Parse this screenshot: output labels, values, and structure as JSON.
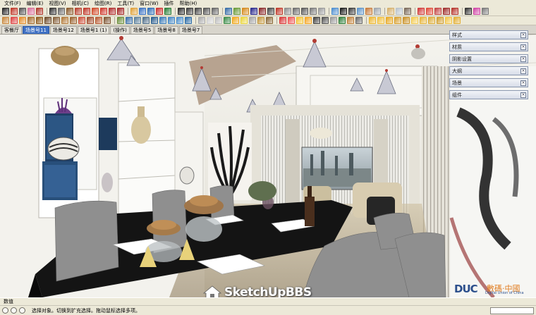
{
  "menu": [
    "文件(F)",
    "编辑(E)",
    "视图(V)",
    "相机(C)",
    "绘图(R)",
    "工具(T)",
    "窗口(W)",
    "插件",
    "帮助(H)"
  ],
  "toolbar_row1": [
    {
      "name": "select-tool-icon",
      "color": "#2a2a2a"
    },
    {
      "name": "pencil-icon",
      "color": "#c0392b"
    },
    {
      "name": "line-tool-icon",
      "color": "#555"
    },
    {
      "name": "eraser-icon",
      "color": "#d86f9a"
    },
    {
      "name": "paint-bucket-icon",
      "color": "#b03a2e"
    },
    {
      "sep": true
    },
    {
      "name": "rectangle-tool-icon",
      "color": "#333"
    },
    {
      "name": "circle-tool-icon",
      "color": "#6b6b6b"
    },
    {
      "name": "polygon-tool-icon",
      "color": "#8a5a2b"
    },
    {
      "name": "arc-tool-icon",
      "color": "#b8412f"
    },
    {
      "name": "push-pull-icon",
      "color": "#c0392b"
    },
    {
      "name": "follow-me-icon",
      "color": "#d14b2a"
    },
    {
      "name": "offset-tool-icon",
      "color": "#cf3a2f"
    },
    {
      "name": "move-tool-icon",
      "color": "#b23030"
    },
    {
      "name": "rotate-tool-icon",
      "color": "#a52a2a"
    },
    {
      "sep": true
    },
    {
      "name": "tape-measure-icon",
      "color": "#e0a23a"
    },
    {
      "name": "protractor-icon",
      "color": "#3b73c4"
    },
    {
      "name": "text-tool-icon",
      "color": "#2f6db5"
    },
    {
      "name": "axes-tool-icon",
      "color": "#c33"
    },
    {
      "name": "dimension-icon",
      "color": "#2b7f3a"
    },
    {
      "sep": true
    },
    {
      "name": "orbit-icon",
      "color": "#2c2c2c"
    },
    {
      "name": "pan-icon",
      "color": "#3d3d3d"
    },
    {
      "name": "zoom-icon",
      "color": "#444"
    },
    {
      "name": "zoom-window-icon",
      "color": "#555"
    },
    {
      "name": "zoom-extents-icon",
      "color": "#666"
    },
    {
      "sep": true
    },
    {
      "name": "component-icon",
      "color": "#3a6ea8"
    },
    {
      "name": "material-icon",
      "color": "#6a9b3a"
    },
    {
      "name": "section-plane-icon",
      "color": "#d68a1e"
    },
    {
      "name": "walk-icon",
      "color": "#2b2b8f"
    },
    {
      "name": "look-around-icon",
      "color": "#8b2b2b"
    },
    {
      "name": "position-camera-icon",
      "color": "#4a4a4a"
    },
    {
      "name": "iso-view-icon",
      "color": "#c0392b"
    },
    {
      "name": "top-view-icon",
      "color": "#8e8e8e"
    },
    {
      "name": "front-view-icon",
      "color": "#6d6d6d"
    },
    {
      "name": "right-view-icon",
      "color": "#5a5a5a"
    },
    {
      "name": "back-view-icon",
      "color": "#7a7a7a"
    },
    {
      "name": "left-view-icon",
      "color": "#9a9a9a"
    },
    {
      "sep": true
    },
    {
      "name": "xray-icon",
      "color": "#4f8fd0"
    },
    {
      "name": "wireframe-icon",
      "color": "#1c1c1c"
    },
    {
      "name": "hidden-line-icon",
      "color": "#3c3c3c"
    },
    {
      "name": "shaded-icon",
      "color": "#5e94c9"
    },
    {
      "name": "shaded-texture-icon",
      "color": "#c77b3c"
    },
    {
      "name": "monochrome-icon",
      "color": "#9fa6ad"
    },
    {
      "sep": true
    },
    {
      "name": "shadow-icon",
      "color": "#d5b06b"
    },
    {
      "name": "fog-icon",
      "color": "#b9c3cc"
    },
    {
      "name": "edge-style-icon",
      "color": "#7b6a5a"
    },
    {
      "sep": true
    },
    {
      "name": "plugin-a-icon",
      "color": "#d23a3a"
    },
    {
      "name": "plugin-b-icon",
      "color": "#e04c3c"
    },
    {
      "name": "plugin-c-icon",
      "color": "#c44646"
    },
    {
      "name": "plugin-d-icon",
      "color": "#a0302f"
    },
    {
      "name": "plugin-e-icon",
      "color": "#b7362f"
    },
    {
      "sep": true
    },
    {
      "name": "text-style-icon",
      "color": "#333"
    },
    {
      "name": "color-wheel-icon",
      "color": "#d247a8"
    },
    {
      "name": "extension-icon",
      "color": "#7a7a7a"
    }
  ],
  "toolbar_row2": [
    {
      "name": "make-group-icon",
      "color": "#c8873c"
    },
    {
      "name": "explode-icon",
      "color": "#d44"
    },
    {
      "name": "flip-icon",
      "color": "#e38d2a"
    },
    {
      "name": "align-icon",
      "color": "#a56a2a"
    },
    {
      "name": "stair-icon",
      "color": "#8f5a1c"
    },
    {
      "name": "railing-icon",
      "color": "#6e4b2a"
    },
    {
      "name": "fence-icon",
      "color": "#86603a"
    },
    {
      "name": "window-tool-icon",
      "color": "#b37a3a"
    },
    {
      "name": "door-tool-icon",
      "color": "#9b6431"
    },
    {
      "name": "roof-icon",
      "color": "#cc4f3a"
    },
    {
      "name": "wall-icon",
      "color": "#a04a2b"
    },
    {
      "name": "column-icon",
      "color": "#b85b33"
    },
    {
      "name": "beam-icon",
      "color": "#7e5533"
    },
    {
      "sep": true
    },
    {
      "name": "array-icon",
      "color": "#6b8e3a"
    },
    {
      "name": "scale-icon",
      "color": "#3b6fa8"
    },
    {
      "name": "round-corner-icon",
      "color": "#5b7f9b"
    },
    {
      "name": "chamfer-icon",
      "color": "#4f6e8a"
    },
    {
      "name": "intersect-icon",
      "color": "#2c5f8f"
    },
    {
      "name": "union-icon",
      "color": "#3a7bb8"
    },
    {
      "name": "subtract-icon",
      "color": "#4286c4"
    },
    {
      "name": "trim-icon",
      "color": "#4b8ecb"
    },
    {
      "name": "split-icon",
      "color": "#2a6aa5"
    },
    {
      "sep": true
    },
    {
      "name": "weld-icon",
      "color": "#a9a9a9"
    },
    {
      "name": "smooth-icon",
      "color": "#cfcfcf"
    },
    {
      "name": "soften-icon",
      "color": "#bcbcbc"
    },
    {
      "name": "outliner-icon",
      "color": "#3c8c4a"
    },
    {
      "name": "layer-icon",
      "color": "#f0a81c"
    },
    {
      "name": "scene-icon",
      "color": "#e9d53a"
    },
    {
      "name": "style-icon",
      "color": "#a3a3a3"
    },
    {
      "name": "sandbox-icon",
      "color": "#c2963b"
    },
    {
      "name": "terrain-icon",
      "color": "#8b6a3a"
    },
    {
      "sep": true
    },
    {
      "name": "render-icon",
      "color": "#d93a3a"
    },
    {
      "name": "render-settings-icon",
      "color": "#e55"
    },
    {
      "name": "light-icon",
      "color": "#f2c230"
    },
    {
      "name": "sun-icon",
      "color": "#f5a623"
    },
    {
      "name": "camera-icon",
      "color": "#444"
    },
    {
      "name": "lens-icon",
      "color": "#555"
    },
    {
      "name": "sphere-icon",
      "color": "#9a9a9a"
    },
    {
      "name": "globe-icon",
      "color": "#2f7f3b"
    },
    {
      "name": "texture-icon",
      "color": "#c0803a"
    },
    {
      "name": "uv-icon",
      "color": "#6a6a6a"
    },
    {
      "sep": true
    },
    {
      "name": "dot-a-icon",
      "color": "#ecb630"
    },
    {
      "name": "dot-b-icon",
      "color": "#f0c040"
    },
    {
      "name": "dot-c-icon",
      "color": "#e8a822"
    },
    {
      "name": "dot-d-icon",
      "color": "#d8a030"
    },
    {
      "name": "dot-e-icon",
      "color": "#c99027"
    },
    {
      "name": "dot-f-icon",
      "color": "#f3cb52"
    },
    {
      "name": "dot-g-icon",
      "color": "#e6b43a"
    },
    {
      "name": "dot-h-icon",
      "color": "#dcac38"
    },
    {
      "name": "dot-i-icon",
      "color": "#d19e2e"
    },
    {
      "name": "dot-j-icon",
      "color": "#f1c448"
    },
    {
      "name": "dot-k-icon",
      "color": "#e2ae33"
    }
  ],
  "scene_tabs": [
    "客餐厅",
    "场景号11",
    "场景号12",
    "场景号1 (1)",
    "(操作)",
    "场景号5",
    "场景号8",
    "场景号7"
  ],
  "active_tab_index": 1,
  "tray": [
    "样式",
    "材质",
    "阴影设置",
    "大纲",
    "场景",
    "组件"
  ],
  "tray_close_glyph": "×",
  "watermark_site": "SketchUpBBS",
  "watermark_brand": {
    "logo": "DUC",
    "cn": "數碼·中國",
    "en": "Digital Union of China"
  },
  "status": {
    "label": "数值",
    "text": "选择对象。切换到扩充选择。拖动鼠标选择多项。"
  },
  "colors": {
    "active_tab": "#3d6fc3",
    "chrome": "#ece9d8",
    "tray_border": "#8b98b0",
    "table": "#111111",
    "chair": "#8d8d8d"
  }
}
